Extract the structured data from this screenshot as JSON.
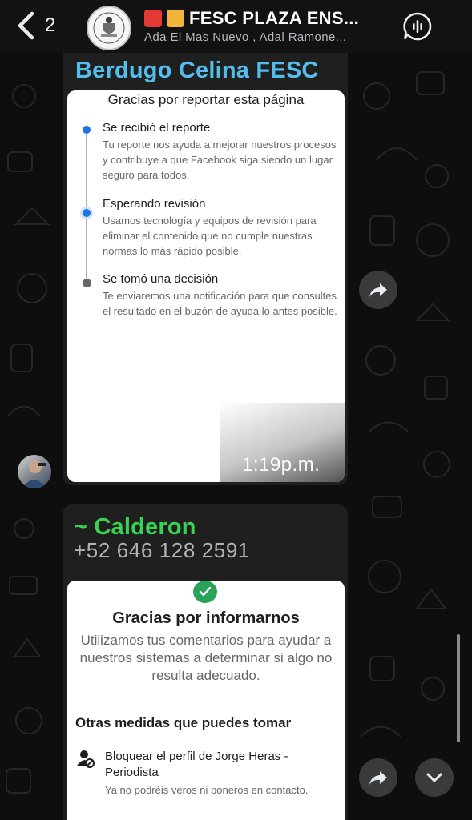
{
  "header": {
    "unread_count": "2",
    "title": "FESC PLAZA ENS...",
    "members": "Ada El Mas Nuevo , Adal Ramone..."
  },
  "messages": [
    {
      "sender": "Berdugo Celina FESC",
      "sender_color": "#53bdeb",
      "card": {
        "title": "Gracias por reportar esta página",
        "steps": [
          {
            "title": "Se recibió el reporte",
            "description": "Tu reporte nos ayuda a mejorar nuestros procesos y contribuye a que Facebook siga siendo un lugar seguro para todos."
          },
          {
            "title": "Esperando revisión",
            "description": "Usamos tecnología y equipos de revisión para eliminar el contenido que no cumple nuestras normas lo más rápido posible."
          },
          {
            "title": "Se tomó una decisión",
            "description": "Te enviaremos una notificación para que consultes el resultado en el buzón de ayuda lo antes posible."
          }
        ]
      },
      "time": "1:19p.m."
    },
    {
      "sender": "~ Calderon",
      "sender_color": "#39d353",
      "phone": "+52 646 128 2591",
      "card": {
        "title": "Gracias por informarnos",
        "description": "Utilizamos tus comentarios para ayudar a nuestros sistemas a determinar si algo no resulta adecuado.",
        "subheading": "Otras medidas que puedes tomar",
        "action_title": "Bloquear el perfil de Jorge Heras - Periodista",
        "action_description": "Ya no podréis veros ni poneros en contacto."
      }
    }
  ],
  "icons": {
    "back": "chevron-left-icon",
    "call": "voice-call-icon",
    "forward": "forward-icon",
    "scroll_down": "chevron-down-icon",
    "check": "check-icon",
    "block": "block-user-icon"
  },
  "colors": {
    "accent_blue": "#1b74e4",
    "check_green": "#29a35a",
    "bubble_bg": "#1f1f1f"
  }
}
